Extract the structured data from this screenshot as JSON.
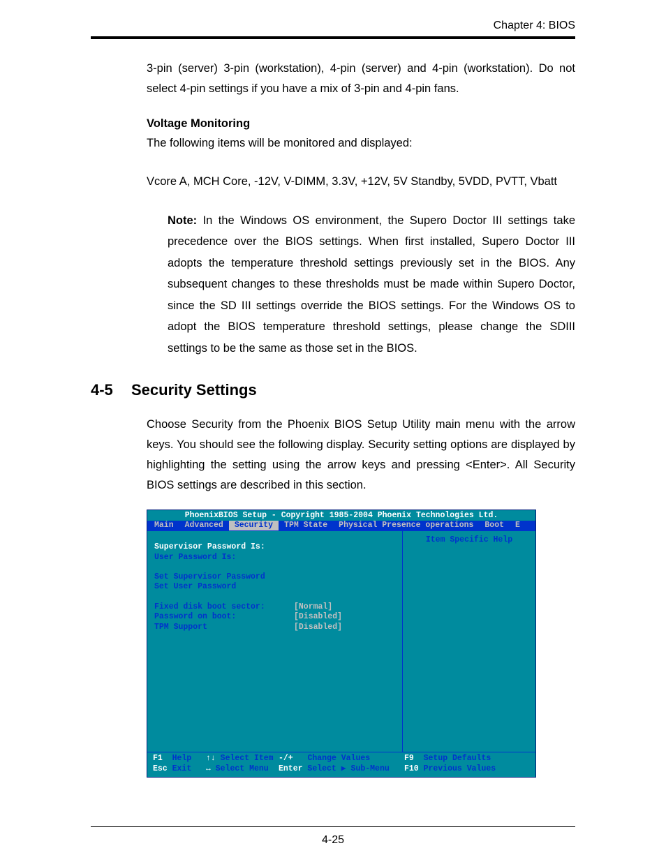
{
  "chapter": "Chapter 4: BIOS",
  "para1": "3-pin (server) 3-pin (workstation), 4-pin (server) and 4-pin (workstation). Do not select 4-pin settings if you have a mix of 3-pin and 4-pin fans.",
  "voltage_heading": "Voltage Monitoring",
  "voltage_intro": "The following items will be monitored and displayed:",
  "voltage_items": "Vcore A, MCH Core, -12V, V-DIMM, 3.3V, +12V, 5V Standby, 5VDD, PVTT, Vbatt",
  "note_label": "Note:",
  "note_body": " In the Windows OS environment, the Supero Doctor III settings take precedence over the BIOS settings. When first installed, Supero Doctor III adopts the temperature threshold settings previously set in the BIOS. Any subsequent changes to these thresholds must be made within Supero Doctor, since the SD III settings override the BIOS settings. For the Windows OS to adopt the BIOS temperature threshold settings, please change the SDIII settings to be the same as those set in the BIOS.",
  "section_num": "4-5",
  "section_title": "Security Settings",
  "section_intro": "Choose Security from the Phoenix BIOS Setup Utility main menu with the arrow keys. You should see the following display. Security setting options are displayed by highlighting the setting using the arrow keys and pressing <Enter>. All Security BIOS settings are described in this section.",
  "bios": {
    "title": "PhoenixBIOS Setup - Copyright 1985-2004 Phoenix Technologies Ltd.",
    "menu": [
      "Main",
      "Advanced",
      "Security",
      "TPM State",
      "Physical Presence operations",
      "Boot",
      "E"
    ],
    "active_menu_index": 2,
    "left": {
      "supervisor": "Supervisor Password Is:",
      "user": "User Password Is:",
      "set_sup": "Set Supervisor Password",
      "set_user": "Set User Password",
      "rows": [
        {
          "label": "Fixed disk boot sector:",
          "value": "[Normal]"
        },
        {
          "label": "Password on boot:",
          "value": "[Disabled]"
        },
        {
          "label": "TPM Support",
          "value": "[Disabled]"
        }
      ]
    },
    "right_title": "Item Specific Help",
    "footer": {
      "f1": "F1",
      "help": "Help",
      "updown": "↑↓",
      "sel_item": "Select Item",
      "pm": "-/+",
      "chg": "Change Values",
      "f9": "F9",
      "defaults": "Setup Defaults",
      "esc": "Esc",
      "exit": "Exit",
      "lr": "↔",
      "sel_menu": "Select Menu",
      "enter": "Enter",
      "sub": "Select ▶ Sub-Menu",
      "f10": "F10",
      "prev": "Previous Values"
    }
  },
  "page_num": "4-25"
}
